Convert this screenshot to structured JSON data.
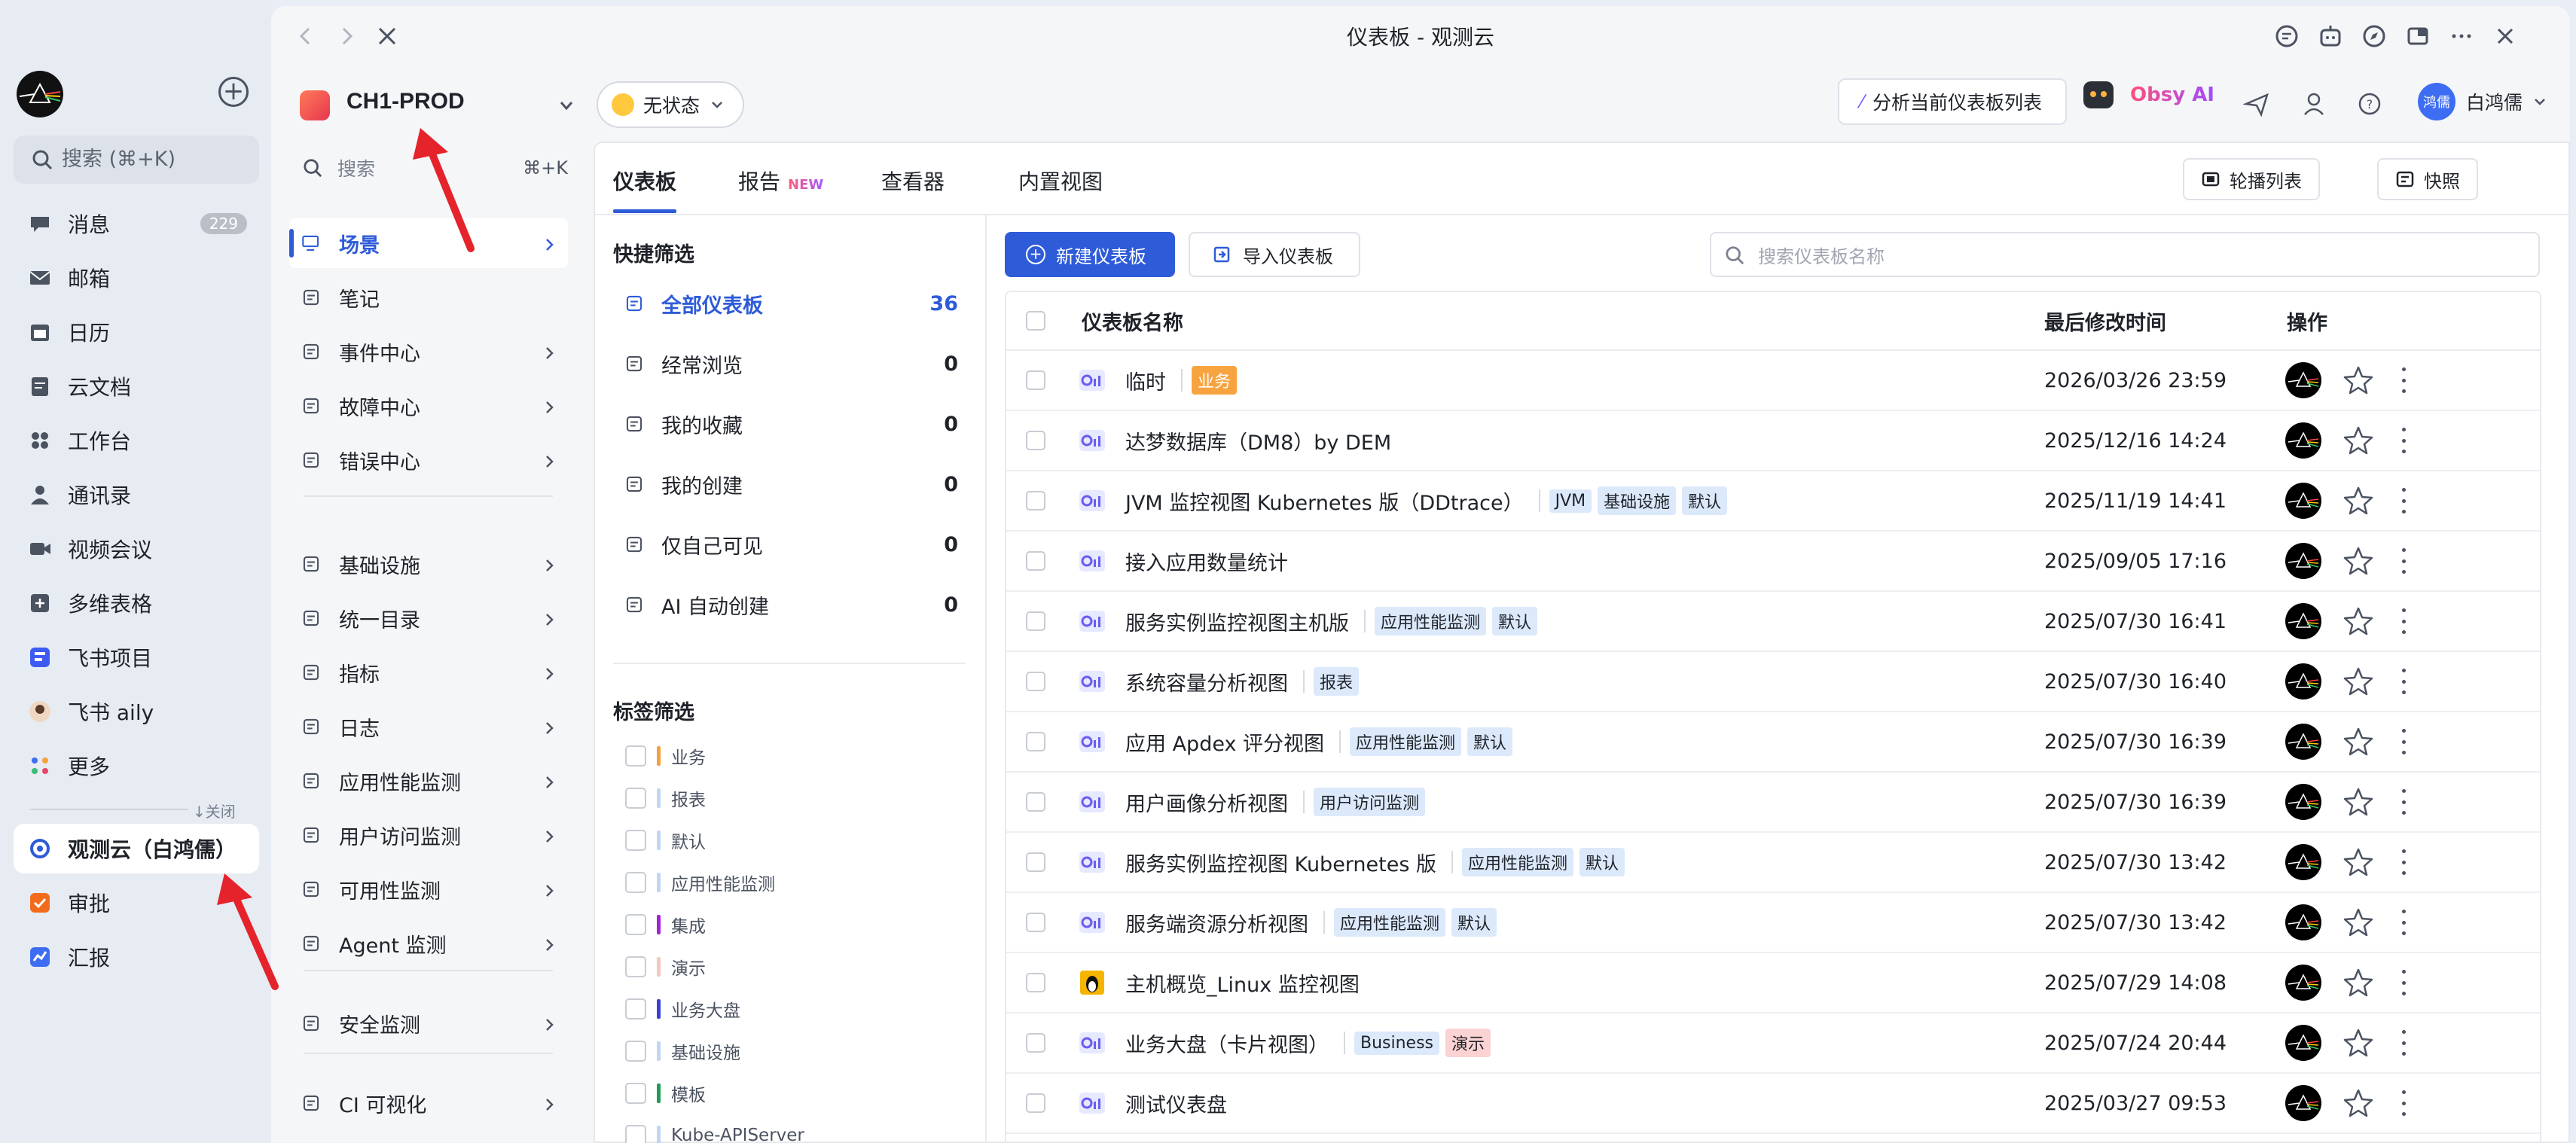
{
  "rail": {
    "search_placeholder": "搜索 (⌘+K)",
    "close_note": "↓关闭",
    "items": [
      {
        "label": "消息",
        "badge": "229",
        "icon": "chat-bubble-icon"
      },
      {
        "label": "邮箱",
        "icon": "mail-icon"
      },
      {
        "label": "日历",
        "icon": "calendar-icon"
      },
      {
        "label": "云文档",
        "icon": "cloud-doc-icon"
      },
      {
        "label": "工作台",
        "icon": "apps-grid-icon"
      },
      {
        "label": "通讯录",
        "icon": "contacts-icon"
      },
      {
        "label": "视频会议",
        "icon": "video-icon"
      },
      {
        "label": "多维表格",
        "icon": "base-table-icon"
      },
      {
        "label": "飞书项目",
        "icon": "project-icon"
      },
      {
        "label": "飞书 aily",
        "icon": "aily-avatar-icon"
      },
      {
        "label": "更多",
        "icon": "more-apps-icon"
      }
    ],
    "pinned": [
      {
        "label": "观测云（白鸿儒）",
        "icon": "guance-icon"
      },
      {
        "label": "审批",
        "icon": "approval-icon"
      },
      {
        "label": "汇报",
        "icon": "report-icon"
      }
    ]
  },
  "window": {
    "title": "仪表板 - 观测云"
  },
  "header": {
    "workspace": "CH1-PROD",
    "status": "无状态",
    "ai_button": "分析当前仪表板列表",
    "obsy": "Obsy AI",
    "user": "白鸿儒",
    "user_avatar_text": "鸿儒"
  },
  "nav": {
    "search_placeholder": "搜索",
    "search_kbd": "⌘+K",
    "items": [
      {
        "label": "场景",
        "icon": "scene-icon",
        "active": true
      },
      {
        "label": "笔记",
        "icon": "notebook-icon"
      },
      {
        "label": "事件中心",
        "icon": "event-icon"
      },
      {
        "label": "故障中心",
        "icon": "incident-icon"
      },
      {
        "label": "错误中心",
        "icon": "bug-icon"
      },
      {
        "label": "基础设施",
        "icon": "infrastructure-icon"
      },
      {
        "label": "统一目录",
        "icon": "catalog-icon"
      },
      {
        "label": "指标",
        "icon": "metrics-icon"
      },
      {
        "label": "日志",
        "icon": "log-icon"
      },
      {
        "label": "应用性能监测",
        "icon": "apm-icon"
      },
      {
        "label": "用户访问监测",
        "icon": "rum-icon"
      },
      {
        "label": "可用性监测",
        "icon": "dial-test-icon"
      },
      {
        "label": "Agent 监测",
        "icon": "agent-icon"
      },
      {
        "label": "安全监测",
        "icon": "shield-icon"
      },
      {
        "label": "CI 可视化",
        "icon": "ci-icon"
      }
    ]
  },
  "main": {
    "tabs": [
      {
        "label": "仪表板",
        "active": true
      },
      {
        "label": "报告",
        "badge": "NEW"
      },
      {
        "label": "查看器"
      },
      {
        "label": "内置视图"
      }
    ],
    "carousel_btn": "轮播列表",
    "snapshot_btn": "快照",
    "quick_filter_title": "快捷筛选",
    "quick_filters": [
      {
        "label": "全部仪表板",
        "count": "36",
        "icon": "grid-icon"
      },
      {
        "label": "经常浏览",
        "count": "0",
        "icon": "history-icon"
      },
      {
        "label": "我的收藏",
        "count": "0",
        "icon": "star-outline-icon"
      },
      {
        "label": "我的创建",
        "count": "0",
        "icon": "user-outline-icon"
      },
      {
        "label": "仅自己可见",
        "count": "0",
        "icon": "private-user-icon"
      },
      {
        "label": "AI 自动创建",
        "count": "0",
        "icon": "ai-spark-icon"
      }
    ],
    "tag_filter_title": "标签筛选",
    "tag_filters": [
      {
        "label": "业务",
        "color": "#f5a13c"
      },
      {
        "label": "报表",
        "color": "#bfd6f6"
      },
      {
        "label": "默认",
        "color": "#bfd6f6"
      },
      {
        "label": "应用性能监测",
        "color": "#bfd6f6"
      },
      {
        "label": "集成",
        "color": "#a024d6"
      },
      {
        "label": "演示",
        "color": "#f6c6c0"
      },
      {
        "label": "业务大盘",
        "color": "#3a3fd6"
      },
      {
        "label": "基础设施",
        "color": "#bfd6f6"
      },
      {
        "label": "模板",
        "color": "#1f9d55"
      },
      {
        "label": "Kube-APIServer",
        "color": "#bfd6f6"
      }
    ],
    "new_dashboard_btn": "新建仪表板",
    "import_btn": "导入仪表板",
    "search_placeholder": "搜索仪表板名称",
    "columns": {
      "name": "仪表板名称",
      "modified": "最后修改时间",
      "ops": "操作"
    },
    "rows": [
      {
        "name": "临时",
        "tags": [
          {
            "t": "业务",
            "s": "orange"
          }
        ],
        "time": "2026/03/26 23:59",
        "icon": "dashboard-chart-icon"
      },
      {
        "name": "达梦数据库（DM8）by DEM",
        "tags": [],
        "time": "2025/12/16 14:24",
        "icon": "dashboard-chart-icon"
      },
      {
        "name": "JVM 监控视图 Kubernetes 版（DDtrace）",
        "tags": [
          {
            "t": "JVM"
          },
          {
            "t": "基础设施"
          },
          {
            "t": "默认"
          }
        ],
        "time": "2025/11/19 14:41",
        "icon": "dashboard-chart-icon"
      },
      {
        "name": "接入应用数量统计",
        "tags": [],
        "time": "2025/09/05 17:16",
        "icon": "dashboard-chart-icon"
      },
      {
        "name": "服务实例监控视图主机版",
        "tags": [
          {
            "t": "应用性能监测"
          },
          {
            "t": "默认"
          }
        ],
        "time": "2025/07/30 16:41",
        "icon": "dashboard-chart-icon"
      },
      {
        "name": "系统容量分析视图",
        "tags": [
          {
            "t": "报表"
          }
        ],
        "time": "2025/07/30 16:40",
        "icon": "dashboard-chart-icon"
      },
      {
        "name": "应用 Apdex 评分视图",
        "tags": [
          {
            "t": "应用性能监测"
          },
          {
            "t": "默认"
          }
        ],
        "time": "2025/07/30 16:39",
        "icon": "dashboard-chart-icon"
      },
      {
        "name": "用户画像分析视图",
        "tags": [
          {
            "t": "用户访问监测"
          }
        ],
        "time": "2025/07/30 16:39",
        "icon": "dashboard-chart-icon"
      },
      {
        "name": "服务实例监控视图 Kubernetes 版",
        "tags": [
          {
            "t": "应用性能监测"
          },
          {
            "t": "默认"
          }
        ],
        "time": "2025/07/30 13:42",
        "icon": "dashboard-chart-icon"
      },
      {
        "name": "服务端资源分析视图",
        "tags": [
          {
            "t": "应用性能监测"
          },
          {
            "t": "默认"
          }
        ],
        "time": "2025/07/30 13:42",
        "icon": "dashboard-chart-icon"
      },
      {
        "name": "主机概览_Linux 监控视图",
        "tags": [],
        "time": "2025/07/29 14:08",
        "icon": "linux-penguin-icon"
      },
      {
        "name": "业务大盘（卡片视图）",
        "tags": [
          {
            "t": "Business"
          },
          {
            "t": "演示",
            "s": "red"
          }
        ],
        "time": "2025/07/24 20:44",
        "icon": "dashboard-chart-icon"
      },
      {
        "name": "测试仪表盘",
        "tags": [],
        "time": "2025/03/27 09:53",
        "icon": "dashboard-chart-icon"
      }
    ]
  },
  "colors": {
    "accent": "#2e5bd8",
    "arrow": "#e5232b"
  }
}
